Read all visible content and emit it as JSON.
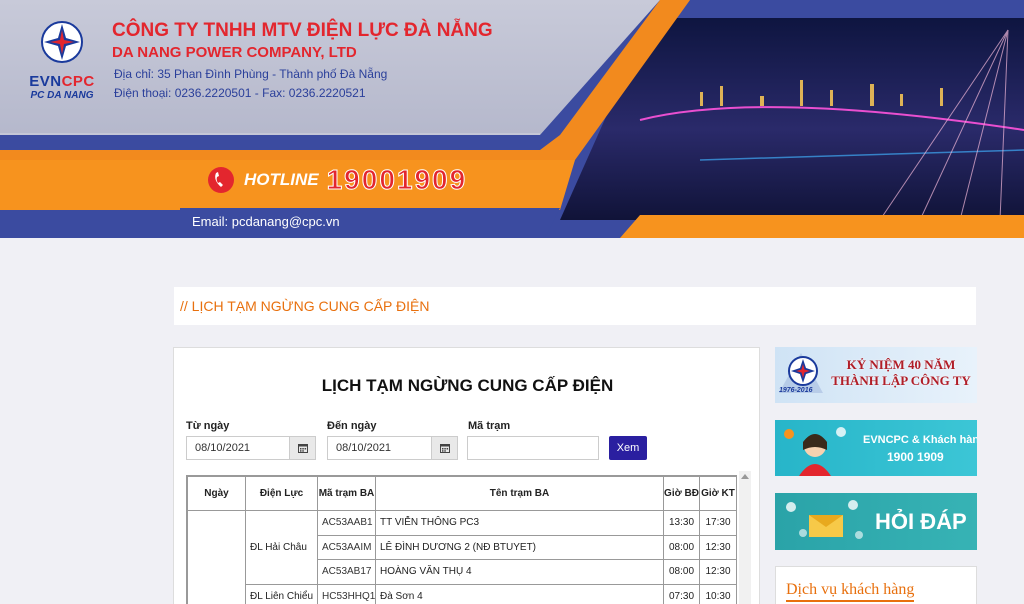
{
  "banner": {
    "logo_evn": "EVN",
    "logo_cpc": "CPC",
    "logo_sub": "PC DA NANG",
    "company_vn": "CÔNG TY TNHH MTV ĐIỆN LỰC ĐÀ NẴNG",
    "company_en": "DA NANG POWER COMPANY, LTD",
    "address": "Địa chỉ: 35 Phan Đình Phùng - Thành phố Đà Nẵng",
    "phone": "Điện thoại: 0236.2220501 - Fax: 0236.2220521",
    "hotline_label": "HOTLINE",
    "hotline_number": "19001909",
    "email": "Email: pcdanang@cpc.vn"
  },
  "heading": "// LỊCH TẠM NGỪNG CUNG CẤP ĐIỆN",
  "main": {
    "title": "LỊCH TẠM NGỪNG CUNG CẤP ĐIỆN",
    "from_label": "Từ ngày",
    "from_value": "08/10/2021",
    "to_label": "Đến ngày",
    "to_value": "08/10/2021",
    "station_label": "Mã trạm",
    "station_value": "",
    "view_button": "Xem"
  },
  "table": {
    "headers": [
      "Ngày",
      "Điện Lực",
      "Mã trạm BA",
      "Tên trạm BA",
      "Giờ BĐ",
      "Giờ KT"
    ],
    "groups": [
      {
        "dien_luc": "ĐL Hải Châu",
        "rows": [
          {
            "ma": "AC53AAB1",
            "ten": "TT VIỄN THÔNG PC3",
            "bd": "13:30",
            "kt": "17:30"
          },
          {
            "ma": "AC53AAIM",
            "ten": "LÊ ĐÌNH DƯƠNG 2 (NĐ BTUYET)",
            "bd": "08:00",
            "kt": "12:30"
          },
          {
            "ma": "AC53AB17",
            "ten": "HOÀNG VĂN THỤ 4",
            "bd": "08:00",
            "kt": "12:30"
          }
        ]
      },
      {
        "dien_luc": "ĐL Liên Chiểu",
        "rows": [
          {
            "ma": "HC53HHQ1",
            "ten": "Đà Sơn 4",
            "bd": "07:30",
            "kt": "10:30"
          }
        ]
      }
    ]
  },
  "sidebar": {
    "anniversary": "KỶ NIỆM 40 NĂM THÀNH LẬP CÔNG TY",
    "anniversary_years": "1976-2016",
    "customer_line1": "EVNCPC & Khách hàng",
    "customer_line2": "1900 1909",
    "faq": "HỎI ĐÁP",
    "services_heading": "Dịch vụ khách hàng"
  },
  "colors": {
    "accent_orange": "#e8700e",
    "brand_blue": "#3b4ba0",
    "brand_red": "#e3262e",
    "button_blue": "#2a1fa0"
  }
}
